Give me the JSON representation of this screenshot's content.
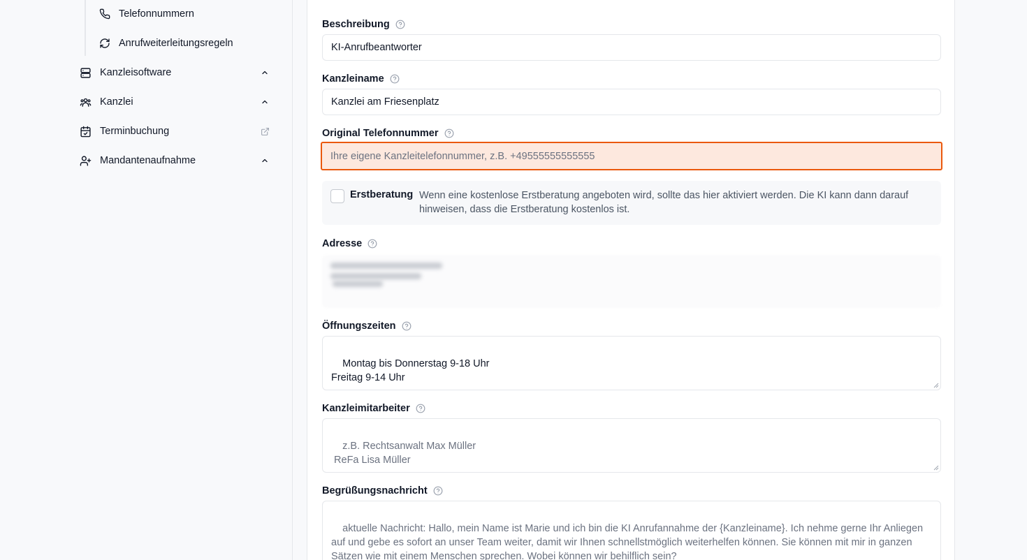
{
  "sidebar": {
    "sub_items": [
      {
        "label": "Telefonnummern",
        "icon": "phone-icon"
      },
      {
        "label": "Anrufweiterleitungsregeln",
        "icon": "refresh-icon"
      }
    ],
    "items": [
      {
        "label": "Kanzleisoftware",
        "icon": "server-icon",
        "tail": "chevron-up-icon"
      },
      {
        "label": "Kanzlei",
        "icon": "users-icon",
        "tail": "chevron-up-icon"
      },
      {
        "label": "Terminbuchung",
        "icon": "calendar-check-icon",
        "tail": "external-link-icon"
      },
      {
        "label": "Mandantenaufnahme",
        "icon": "user-plus-icon",
        "tail": "chevron-up-icon"
      }
    ]
  },
  "form": {
    "beschreibung": {
      "label": "Beschreibung",
      "value": "KI-Anrufbeantworter"
    },
    "kanzleiname": {
      "label": "Kanzleiname",
      "value": "Kanzlei am Friesenplatz"
    },
    "telefon": {
      "label": "Original Telefonnummer",
      "placeholder": "Ihre eigene Kanzleitelefonnummer, z.B. +49555555555555"
    },
    "erstberatung": {
      "label": "Erstberatung",
      "description": "Wenn eine kostenlose Erstberatung angeboten wird, sollte das hier aktiviert werden. Die KI kann dann darauf hinweisen, dass die Erstberatung kostenlos ist.",
      "checked": false
    },
    "adresse": {
      "label": "Adresse"
    },
    "oeffnungszeiten": {
      "label": "Öffnungszeiten",
      "value": "Montag bis Donnerstag 9-18 Uhr\nFreitag 9-14 Uhr"
    },
    "mitarbeiter": {
      "label": "Kanzleimitarbeiter",
      "placeholder": "z.B. Rechtsanwalt Max Müller\n ReFa Lisa Müller"
    },
    "begruessung": {
      "label": "Begrüßungsnachricht",
      "placeholder": "aktuelle Nachricht: Hallo, mein Name ist Marie und ich bin die KI Anrufannahme der {Kanzleiname}. Ich nehme gerne Ihr Anliegen auf und gebe es sofort an unser Team weiter, damit wir Ihnen schnellstmöglich weiterhelfen können. Sie können mit mir in ganzen Sätzen wie mit einem Menschen sprechen. Wobei können wir behilflich sein?"
    }
  },
  "colors": {
    "error_border": "#ea580c",
    "error_bg": "#fde8de"
  }
}
